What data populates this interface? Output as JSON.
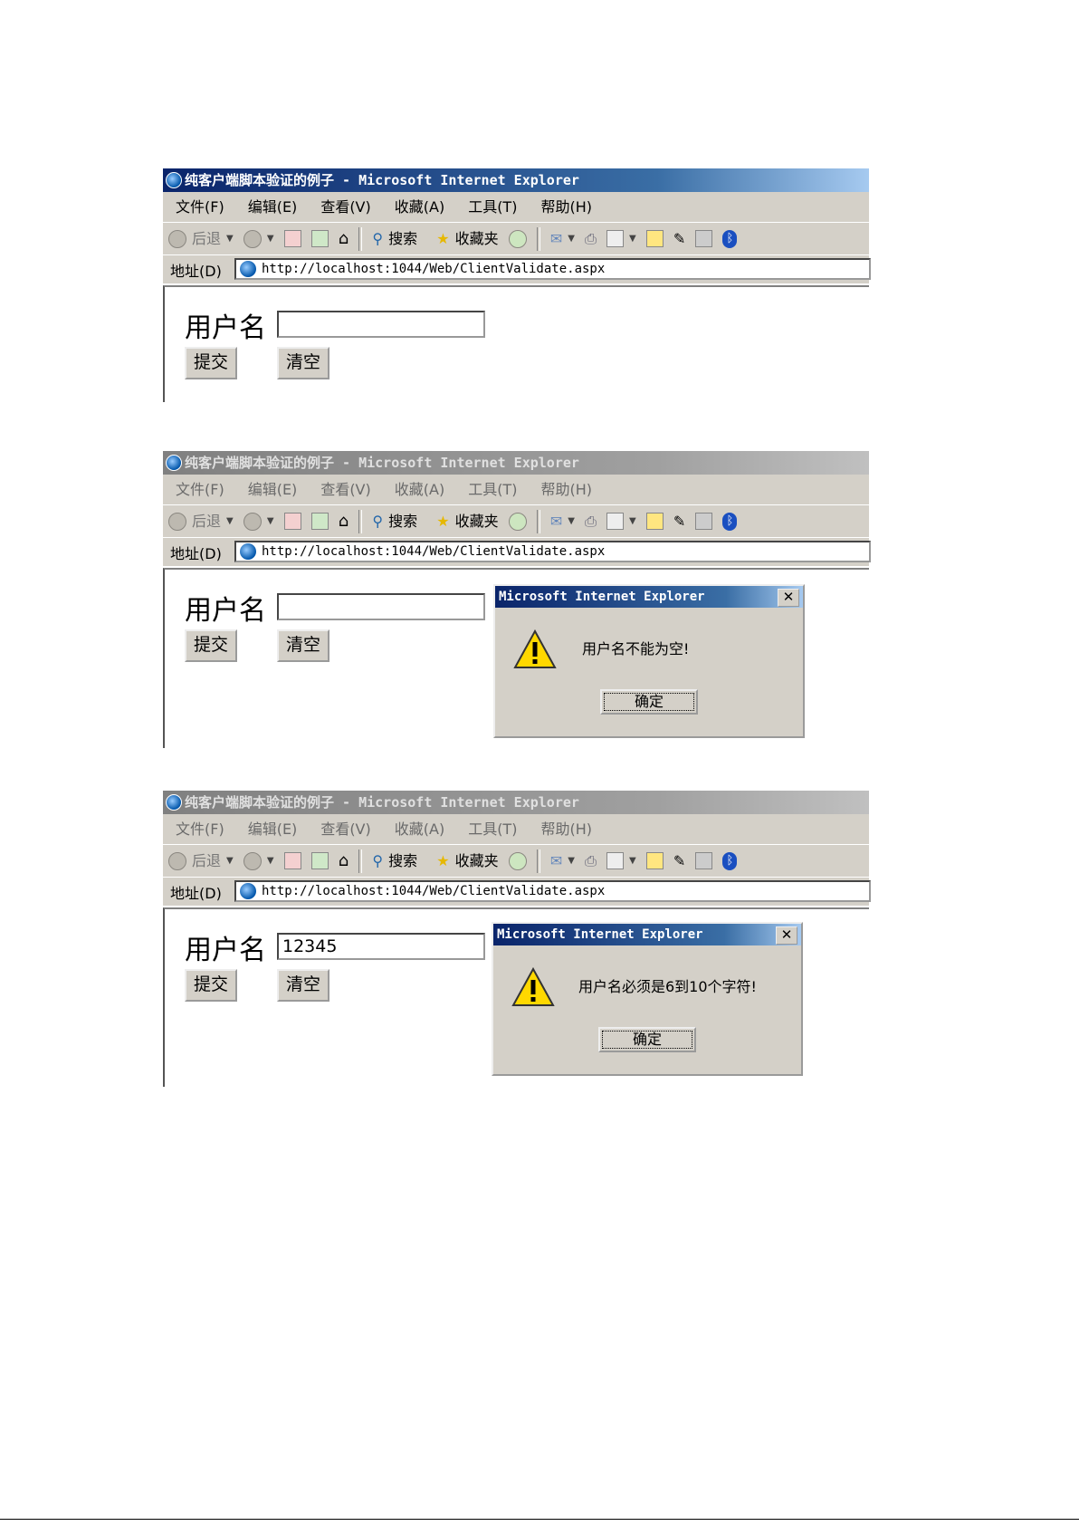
{
  "browser": {
    "window_title": "纯客户端脚本验证的例子 - Microsoft Internet Explorer",
    "menu": [
      "文件(F)",
      "编辑(E)",
      "查看(V)",
      "收藏(A)",
      "工具(T)",
      "帮助(H)"
    ],
    "toolbar": {
      "back_label": "后退",
      "search_label": "搜索",
      "favorites_label": "收藏夹"
    },
    "address_label": "地址(D)",
    "address_url": "http://localhost:1044/Web/ClientValidate.aspx"
  },
  "form": {
    "username_label": "用户名",
    "submit_label": "提交",
    "clear_label": "清空"
  },
  "screens": [
    {
      "username_value": ""
    },
    {
      "username_value": "",
      "dialog": {
        "title": "Microsoft Internet Explorer",
        "message": "用户名不能为空!",
        "ok_label": "确定"
      }
    },
    {
      "username_value": "12345",
      "dialog": {
        "title": "Microsoft Internet Explorer",
        "message": "用户名必须是6到10个字符!",
        "ok_label": "确定"
      }
    }
  ],
  "icons": [
    "ie-icon",
    "back-icon",
    "forward-icon",
    "stop-icon",
    "refresh-icon",
    "home-icon",
    "search-icon",
    "favorites-star-icon",
    "media-icon",
    "mail-icon",
    "print-icon",
    "edit-icon",
    "messenger-icon",
    "research-icon",
    "bluetooth-icon",
    "warning-icon",
    "close-icon"
  ]
}
